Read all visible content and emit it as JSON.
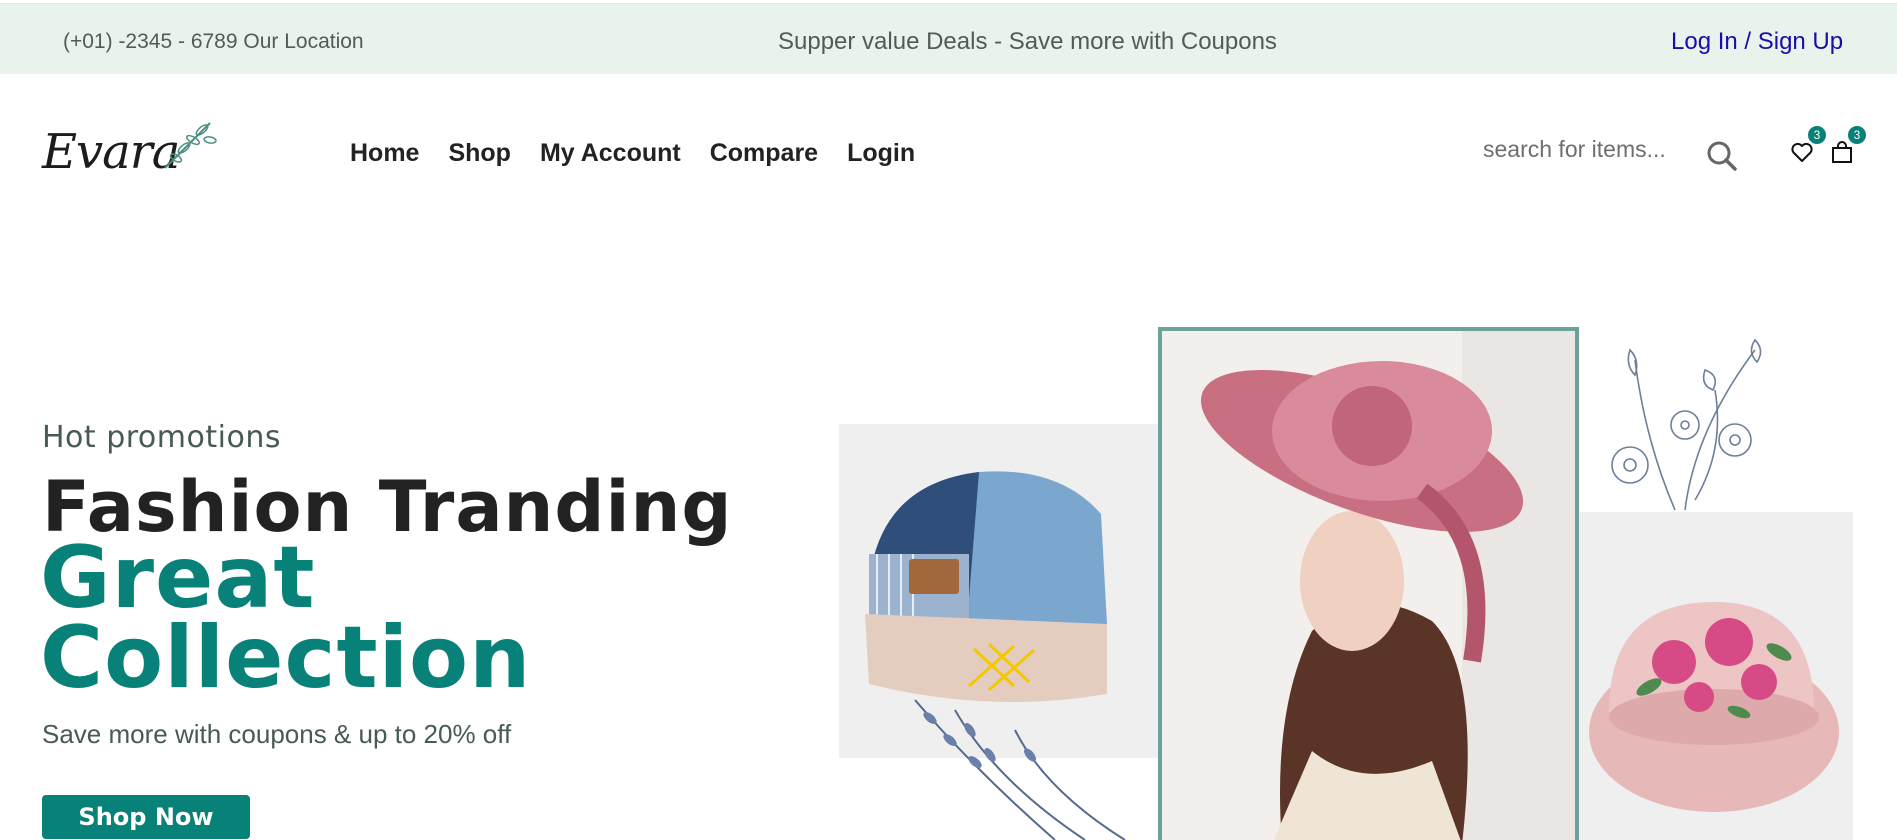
{
  "topbar": {
    "phone": "(+01) -2345 - 6789 Our Location",
    "deals": "Supper value Deals - Save more with Coupons",
    "auth_link": "Log In / Sign Up"
  },
  "header": {
    "logo_text": "Evara",
    "nav": [
      "Home",
      "Shop",
      "My Account",
      "Compare",
      "Login"
    ],
    "search_placeholder": "search for items...",
    "wishlist_count": "3",
    "cart_count": "3"
  },
  "hero": {
    "subtitle": "Hot promotions",
    "title": "Fashion Tranding",
    "accent": "Great Collection",
    "description": "Save more with coupons & up to 20% off",
    "cta": "Shop Now"
  },
  "colors": {
    "brand": "#088178",
    "topbar_bg": "#e8f3ec",
    "link_blue": "#1a0dab"
  },
  "icons": [
    "search-icon",
    "heart-icon",
    "shopping-bag-icon",
    "leaf-icon"
  ]
}
